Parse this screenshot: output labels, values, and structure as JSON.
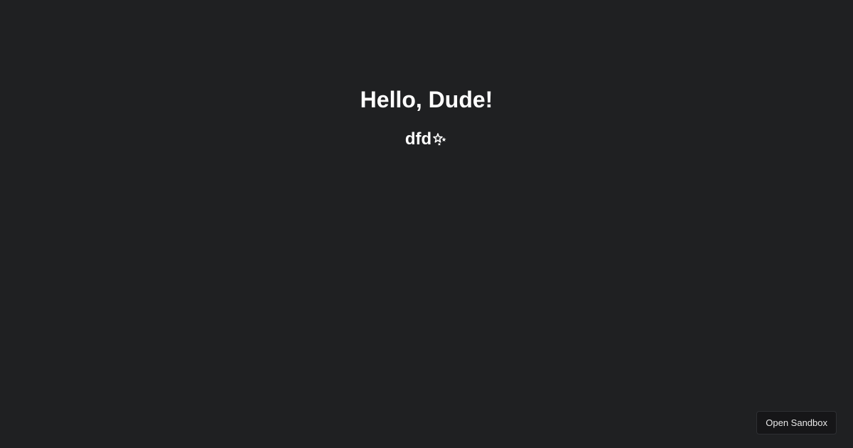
{
  "main": {
    "heading": "Hello, Dude!",
    "subheading": "dfd",
    "subheading_icon": "sparkles-icon"
  },
  "footer": {
    "open_sandbox_label": "Open Sandbox"
  },
  "colors": {
    "background": "#1f2022",
    "text": "#ffffff",
    "button_background": "#161618",
    "button_border": "#2e2f33"
  }
}
